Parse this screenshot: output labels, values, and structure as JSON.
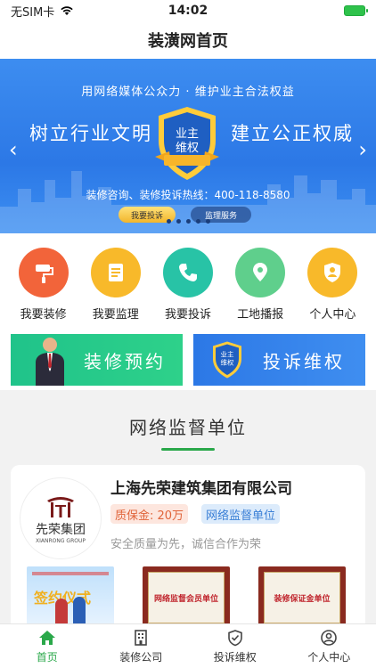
{
  "status_bar": {
    "carrier": "无SIM卡",
    "time": "14:02"
  },
  "nav": {
    "title": "装潢网首页"
  },
  "banner": {
    "slogan": "用网络媒体公众力 · 维护业主合法权益",
    "left_text": "树立行业文明",
    "right_text": "建立公正权威",
    "shield_line1": "业主",
    "shield_line2": "维权",
    "hotline": "装修咨询、装修投诉热线：400-118-8580",
    "btn_complain": "我要投诉",
    "btn_supervise": "监理服务"
  },
  "grid": [
    {
      "label": "我要装修",
      "icon": "paint-roller-icon",
      "color": "#f2643a"
    },
    {
      "label": "我要监理",
      "icon": "checklist-icon",
      "color": "#f8b92a"
    },
    {
      "label": "我要投诉",
      "icon": "phone-icon",
      "color": "#28c3a6"
    },
    {
      "label": "工地播报",
      "icon": "location-pin-icon",
      "color": "#5fcf8c"
    },
    {
      "label": "个人中心",
      "icon": "user-shield-icon",
      "color": "#f8b92a"
    }
  ],
  "promo": {
    "left": "装修预约",
    "right": "投诉维权",
    "right_shield_line1": "业主",
    "right_shield_line2": "维权"
  },
  "section": {
    "title": "网络监督单位"
  },
  "company": {
    "name": "上海先荣建筑集团有限公司",
    "logo_cn": "先荣集团",
    "logo_en": "XIANRONG GROUP",
    "deposit": "质保金: 20万",
    "unit": "网络监督单位",
    "motto": "安全质量为先，诚信合作为荣",
    "thumb1_title": "签约仪式",
    "thumb2_text": "网络监督会员单位",
    "thumb3_text": "装修保证金单位"
  },
  "tabbar": [
    {
      "label": "首页",
      "icon": "home-icon",
      "active": true
    },
    {
      "label": "装修公司",
      "icon": "building-icon",
      "active": false
    },
    {
      "label": "投诉维权",
      "icon": "shield-check-icon",
      "active": false
    },
    {
      "label": "个人中心",
      "icon": "user-circle-icon",
      "active": false
    }
  ],
  "colors": {
    "accent": "#2aa84a",
    "banner": "#2c78e6"
  }
}
